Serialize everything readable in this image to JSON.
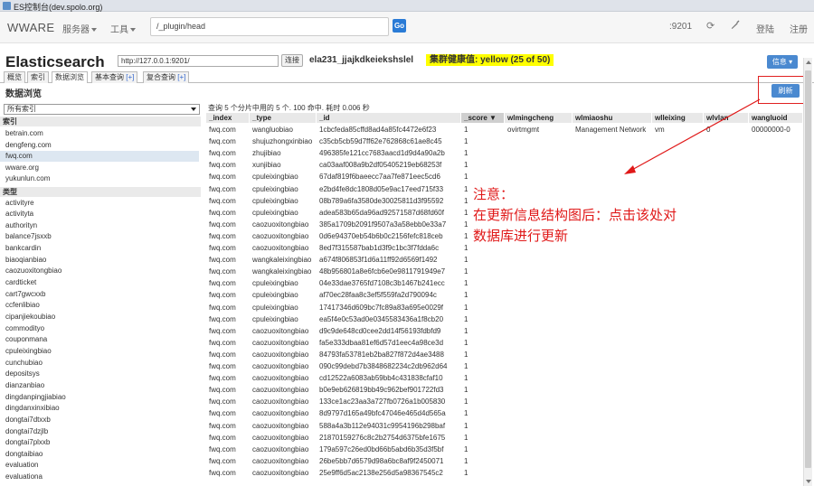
{
  "window": {
    "title": "ES控制台(dev.spolo.org)"
  },
  "nav": {
    "brand": "WWARE",
    "menus": [
      {
        "label": "服务器"
      },
      {
        "label": "工具"
      }
    ],
    "url_value": "/_plugin/head",
    "go_label": "Go",
    "port_label": ":9201",
    "refresh_icon": "refresh-icon",
    "wrench_icon": "wrench-icon",
    "login_label": "登陆",
    "register_label": "注册"
  },
  "head": {
    "title": "Elasticsearch",
    "connect_value": "http://127.0.0.1:9201/",
    "connect_label": "连接",
    "cluster_name": "ela231_jjajkdkeiekshslel",
    "health": "集群健康值: yellow (25 of 50)",
    "info_label": "信息",
    "tabs": [
      {
        "label": "概览",
        "plus": ""
      },
      {
        "label": "索引",
        "plus": ""
      },
      {
        "label": "数据浏览",
        "plus": ""
      },
      {
        "label": "基本查询",
        "plus": "[+]"
      },
      {
        "label": "复合查询",
        "plus": "[+]"
      }
    ]
  },
  "browser": {
    "section_title": "数据浏览",
    "refresh_label": "刷新",
    "index_select": "所有索引",
    "indices_header": "索引",
    "indices": [
      "betrain.com",
      "dengfeng.com",
      "fwq.com",
      "wware.org",
      "yukunlun.com"
    ],
    "selected_index": "fwq.com",
    "types_header": "类型",
    "types": [
      "activityre",
      "activityta",
      "authorityn",
      "balance7jsxxb",
      "bankcardin",
      "biaoqianbiao",
      "caozuoxitongbiao",
      "cardticket",
      "cart7gwcxxb",
      "ccfenlibiao",
      "cipanjiekoubiao",
      "commodityo",
      "couponmana",
      "cpuleixingbiao",
      "cunchubiao",
      "depositsys",
      "dianzanbiao",
      "dingdanpingjiabiao",
      "dingdanxinxibiao",
      "dongtai7dtxxb",
      "dongtai7dzjlb",
      "dongtai7plxxb",
      "dongtaibiao",
      "evaluation",
      "evaluationa"
    ],
    "summary": "查询 5 个分片中用的 5 个. 100 命中. 耗时 0.006 秒",
    "columns": [
      "_index",
      "_type",
      "_id",
      "_score ▼",
      "wlmingcheng",
      "wlmiaoshu",
      "wlleixing",
      "wlvlan",
      "wangluoid"
    ],
    "rows": [
      {
        "index": "fwq.com",
        "type": "wangluobiao",
        "id": "1cbcfeda85cffd8ad4a85fc4472e6f23",
        "score": "1",
        "wlmingcheng": "ovirtmgmt",
        "wlmiaoshu": "Management Network",
        "wlleixing": "vm",
        "wlvlan": "0",
        "wangluoid": "00000000-0"
      },
      {
        "index": "fwq.com",
        "type": "shujuzhongxinbiao",
        "id": "c35cb5cb59d7ff62e762868c61ae8c45",
        "score": "1"
      },
      {
        "index": "fwq.com",
        "type": "zhujibiao",
        "id": "496385fe121cc7683aacd1d9d4a90a2b",
        "score": "1"
      },
      {
        "index": "fwq.com",
        "type": "xunjibiao",
        "id": "ca03aaf008a9b2df05405219eb68253f",
        "score": "1"
      },
      {
        "index": "fwq.com",
        "type": "cpuleixingbiao",
        "id": "67daf819f6baeecc7aa7fe871eec5cd6",
        "score": "1"
      },
      {
        "index": "fwq.com",
        "type": "cpuleixingbiao",
        "id": "e2bd4fe8dc1808d05e9ac17eed715f33",
        "score": "1"
      },
      {
        "index": "fwq.com",
        "type": "cpuleixingbiao",
        "id": "08b789a6fa3580de30025811d3f95592",
        "score": "1"
      },
      {
        "index": "fwq.com",
        "type": "cpuleixingbiao",
        "id": "adea583b65da96ad92571587d68fd60f",
        "score": "1"
      },
      {
        "index": "fwq.com",
        "type": "caozuoxitongbiao",
        "id": "385a1709b2091f9507a3a58ebb0e33a7",
        "score": "1"
      },
      {
        "index": "fwq.com",
        "type": "caozuoxitongbiao",
        "id": "0d6e94370eb54b6b0c2156fefc818ceb",
        "score": "1"
      },
      {
        "index": "fwq.com",
        "type": "caozuoxitongbiao",
        "id": "8ed7f315587bab1d3f9c1bc3f7fdda6c",
        "score": "1"
      },
      {
        "index": "fwq.com",
        "type": "wangkaleixingbiao",
        "id": "a674f806853f1d6a11ff92d6569f1492",
        "score": "1"
      },
      {
        "index": "fwq.com",
        "type": "wangkaleixingbiao",
        "id": "48b956801a8e6fcb6e0e9811791949e7",
        "score": "1"
      },
      {
        "index": "fwq.com",
        "type": "cpuleixingbiao",
        "id": "04e33dae3765fd7108c3b1467b241ecc",
        "score": "1"
      },
      {
        "index": "fwq.com",
        "type": "cpuleixingbiao",
        "id": "af70ec28faa8c3ef5f559fa2d790094c",
        "score": "1"
      },
      {
        "index": "fwq.com",
        "type": "cpuleixingbiao",
        "id": "17417346d609bc7fc89a83a695e0029f",
        "score": "1"
      },
      {
        "index": "fwq.com",
        "type": "cpuleixingbiao",
        "id": "ea5f4e0c53ad0e0345583436a1f8cb20",
        "score": "1"
      },
      {
        "index": "fwq.com",
        "type": "caozuoxitongbiao",
        "id": "d9c9de648cd0cee2dd14f56193fdbfd9",
        "score": "1"
      },
      {
        "index": "fwq.com",
        "type": "caozuoxitongbiao",
        "id": "fa5e333dbaa81ef6d57d1eec4a98ce3d",
        "score": "1"
      },
      {
        "index": "fwq.com",
        "type": "caozuoxitongbiao",
        "id": "84793fa53781eb2ba827f872d4ae3488",
        "score": "1"
      },
      {
        "index": "fwq.com",
        "type": "caozuoxitongbiao",
        "id": "090c99debd7b3848682234c2db962d64",
        "score": "1"
      },
      {
        "index": "fwq.com",
        "type": "caozuoxitongbiao",
        "id": "cd12522a6083ab59bb4c431838cfaf10",
        "score": "1"
      },
      {
        "index": "fwq.com",
        "type": "caozuoxitongbiao",
        "id": "b0e9eb626819bb49c962bef901722fd3",
        "score": "1"
      },
      {
        "index": "fwq.com",
        "type": "caozuoxitongbiao",
        "id": "133ce1ac23aa3a727fb0726a1b005830",
        "score": "1"
      },
      {
        "index": "fwq.com",
        "type": "caozuoxitongbiao",
        "id": "8d9797d165a49bfc47046e465d4d565a",
        "score": "1"
      },
      {
        "index": "fwq.com",
        "type": "caozuoxitongbiao",
        "id": "588a4a3b112e94031c9954196b298baf",
        "score": "1"
      },
      {
        "index": "fwq.com",
        "type": "caozuoxitongbiao",
        "id": "21870159276c8c2b2754d6375bfe1675",
        "score": "1"
      },
      {
        "index": "fwq.com",
        "type": "caozuoxitongbiao",
        "id": "179a597c26ed0bd66b5abd6b35d3f5bf",
        "score": "1"
      },
      {
        "index": "fwq.com",
        "type": "caozuoxitongbiao",
        "id": "26be5bb7d6579d98a6bc8af9f2450071",
        "score": "1"
      },
      {
        "index": "fwq.com",
        "type": "caozuoxitongbiao",
        "id": "25e9ff6d5ac2138e256d5a98367545c2",
        "score": "1"
      }
    ]
  },
  "annotation": {
    "lines": [
      "注意：",
      "在更新信息结构图后：点击该处对",
      "数据库进行更新"
    ],
    "color": "#e01818"
  }
}
